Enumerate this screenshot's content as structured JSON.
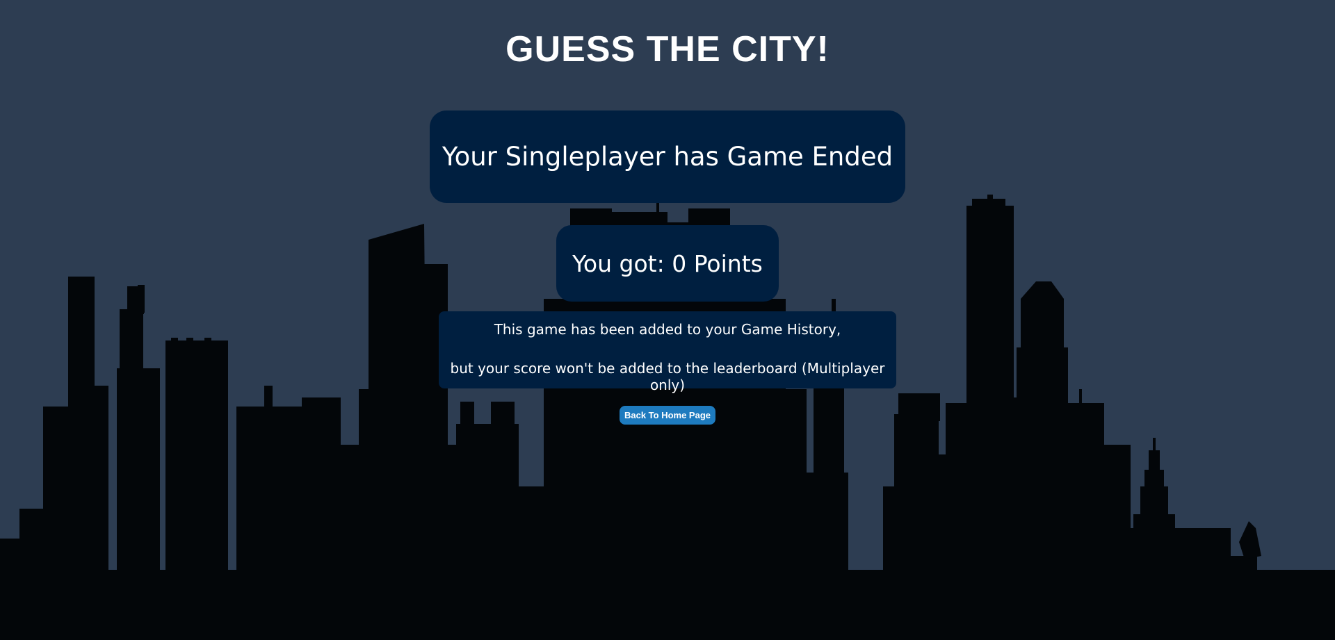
{
  "page": {
    "title": "GUESS THE CITY!"
  },
  "result": {
    "ended_text": "Your Singleplayer has Game Ended",
    "points_text": "You got: 0 Points",
    "info_line_1": "This game has been added to your Game History,",
    "info_line_2": "but your score won't be added to the leaderboard (Multiplayer only)"
  },
  "actions": {
    "home_button_label": "Back To Home Page"
  },
  "colors": {
    "background": "#2d3d52",
    "skyline": "#030609",
    "panel": "#001f40",
    "button": "#1e7bbf",
    "text": "#ffffff"
  }
}
